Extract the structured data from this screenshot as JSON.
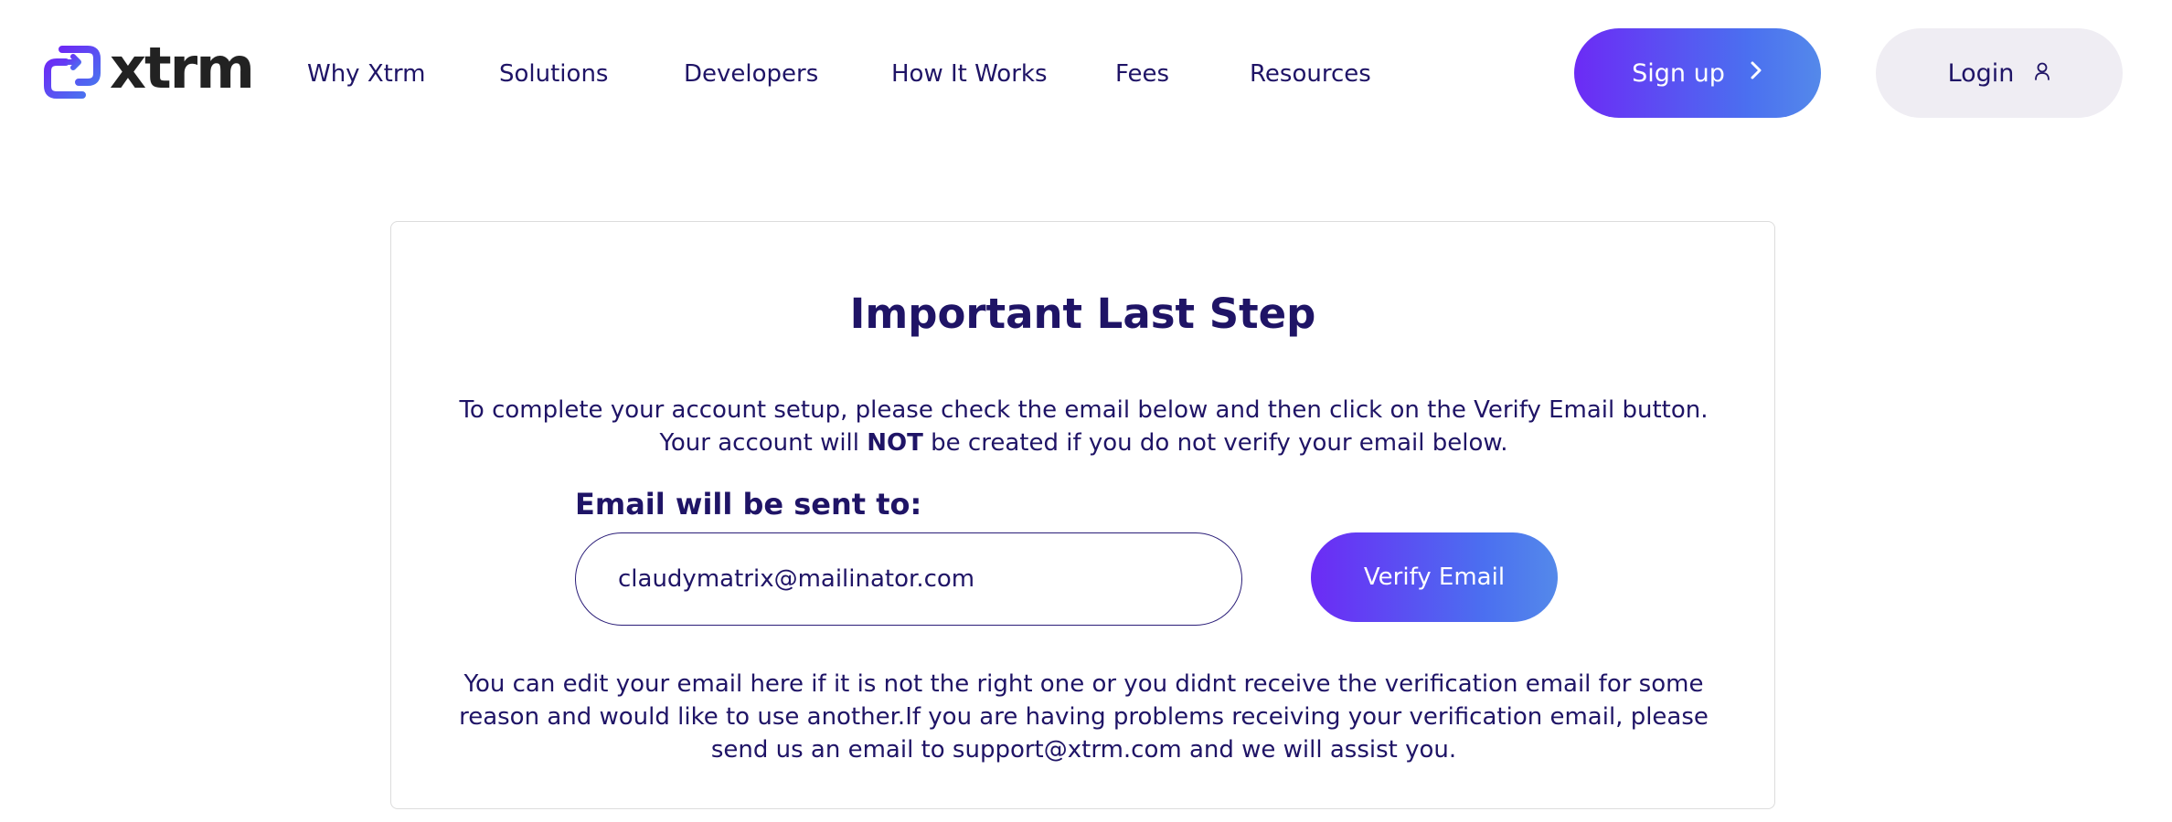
{
  "header": {
    "logo_text": "xtrm",
    "nav": [
      {
        "label": "Why Xtrm"
      },
      {
        "label": "Solutions"
      },
      {
        "label": "Developers"
      },
      {
        "label": "How It Works"
      },
      {
        "label": "Fees"
      },
      {
        "label": "Resources"
      }
    ],
    "signup_label": "Sign up",
    "login_label": "Login",
    "brand_color": "#6c2bf5",
    "brand_gradient_end": "#5489ea"
  },
  "card": {
    "title": "Important Last Step",
    "intro_before": "To complete your account setup, please check the email below and then click on the Verify Email button. Your account will ",
    "intro_bold": "NOT",
    "intro_after": " be created if you do not verify your email below.",
    "email_label": "Email will be sent to:",
    "email_value": "claudymatrix@mailinator.com",
    "verify_label": "Verify Email",
    "help_text": "You can edit your email here if it is not the right one or you didnt receive the verification email for some reason and would like to use another.If you are having problems receiving your verification email, please send us an email to support@xtrm.com and we will assist you."
  }
}
